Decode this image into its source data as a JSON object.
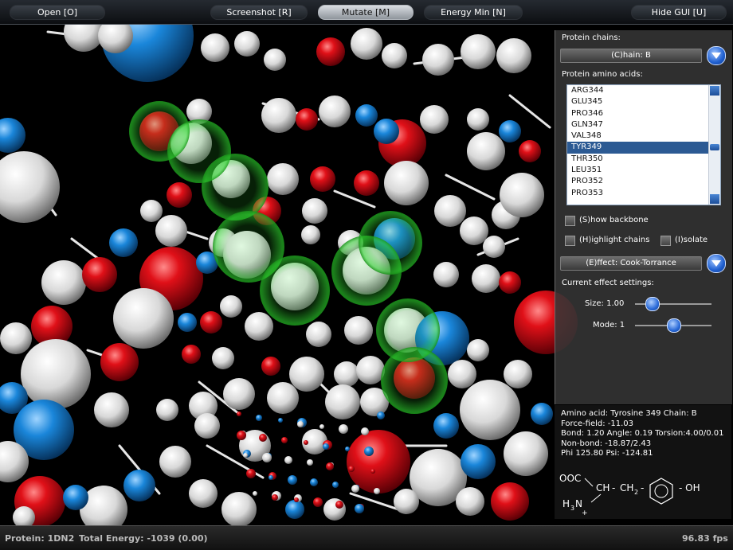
{
  "toolbar": {
    "buttons": [
      {
        "label": "Open [O]"
      },
      {
        "label": "Screenshot [R]"
      },
      {
        "label": "Mutate [M]",
        "active": true
      },
      {
        "label": "Energy Min [N]"
      },
      {
        "label": "Hide GUI [U]"
      }
    ]
  },
  "panel": {
    "chains_label": "Protein chains:",
    "chain_value": "(C)hain: B",
    "amino_label": "Protein amino acids:",
    "amino_acids": [
      "ARG344",
      "GLU345",
      "PRO346",
      "GLN347",
      "VAL348",
      "TYR349",
      "THR350",
      "LEU351",
      "PRO352",
      "PRO353"
    ],
    "selected_amino": "TYR349",
    "show_backbone": "(S)how backbone",
    "highlight_chains": "(H)ighlight chains",
    "isolate": "(I)solate",
    "effect_value": "(E)ffect: Cook-Torrance",
    "effect_settings_label": "Current effect settings:",
    "size_label": "Size: 1.00",
    "size_fraction": 0.22,
    "mode_label": "Mode: 1",
    "mode_fraction": 0.5
  },
  "info": {
    "amino_acid": "Amino acid: Tyrosine 349  Chain: B",
    "force_field": "Force-field: -11.03",
    "bond": "Bond: 1.20 Angle: 0.19 Torsion:4.00/0.01",
    "non_bond": "Non-bond: -18.87/2.43",
    "phi_psi": "Phi 125.80 Psi: -124.81",
    "formula": {
      "ooc": "OOC",
      "ch": "CH",
      "ch2": "CH",
      "sub2": "2",
      "oh": "- OH",
      "h3n": "H",
      "sub3": "3",
      "n": "N",
      "plus": "+",
      "dash": "-"
    }
  },
  "status": {
    "protein": "Protein: 1DN2",
    "energy": "Total Energy: -1039 (0.00)",
    "fps": "96.83 fps"
  },
  "colors": {
    "background": "#000000",
    "oxygen": "#e0121a",
    "nitrogen": "#1e84d8",
    "carbon": "#f2f2f2",
    "bond": "#ffffff",
    "highlight": "#29d32a",
    "selection": "#2c5a93"
  }
}
